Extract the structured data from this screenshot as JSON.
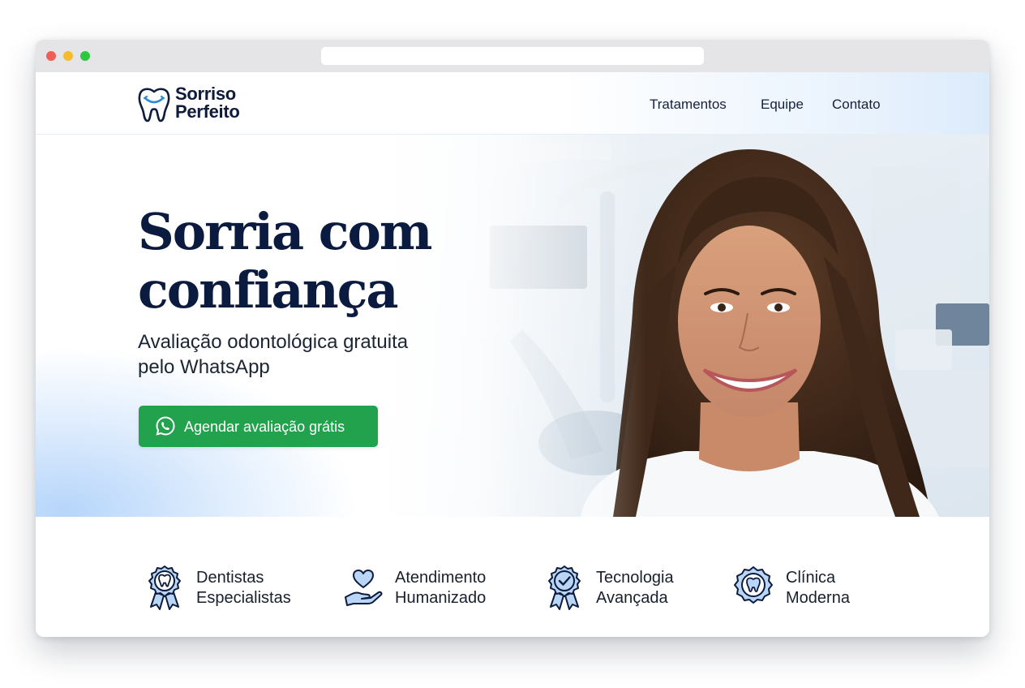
{
  "browser": {
    "url": ""
  },
  "brand": {
    "name_line1": "Sorriso",
    "name_line2": "Perfeito",
    "color": "#0d1b3d",
    "logo_icon": "tooth-smile-icon"
  },
  "nav": {
    "items": [
      {
        "label": "Tratamentos"
      },
      {
        "label": "Equipe"
      },
      {
        "label": "Contato"
      }
    ]
  },
  "hero": {
    "title_line1": "Sorria com",
    "title_line2": "confiança",
    "subtitle_line1": "Avaliação odontológica gratuita",
    "subtitle_line2": "pelo WhatsApp",
    "cta_label": "Agendar avaliação grátis",
    "cta_icon": "whatsapp-icon",
    "cta_color": "#22a24d",
    "image": "smiling-woman-in-dental-clinic"
  },
  "features": [
    {
      "line1": "Dentistas",
      "line2": "Especialistas",
      "icon": "award-tooth-icon"
    },
    {
      "line1": "Atendimento",
      "line2": "Humanizado",
      "icon": "heart-hand-icon"
    },
    {
      "line1": "Tecnologia",
      "line2": "Avançada",
      "icon": "award-check-icon"
    },
    {
      "line1": "Clínica",
      "line2": "Moderna",
      "icon": "tooth-badge-icon"
    }
  ],
  "colors": {
    "accent_blue": "#1f6fb8",
    "icon_fill": "#b9d6f6",
    "text_dark": "#0b1a3f"
  }
}
